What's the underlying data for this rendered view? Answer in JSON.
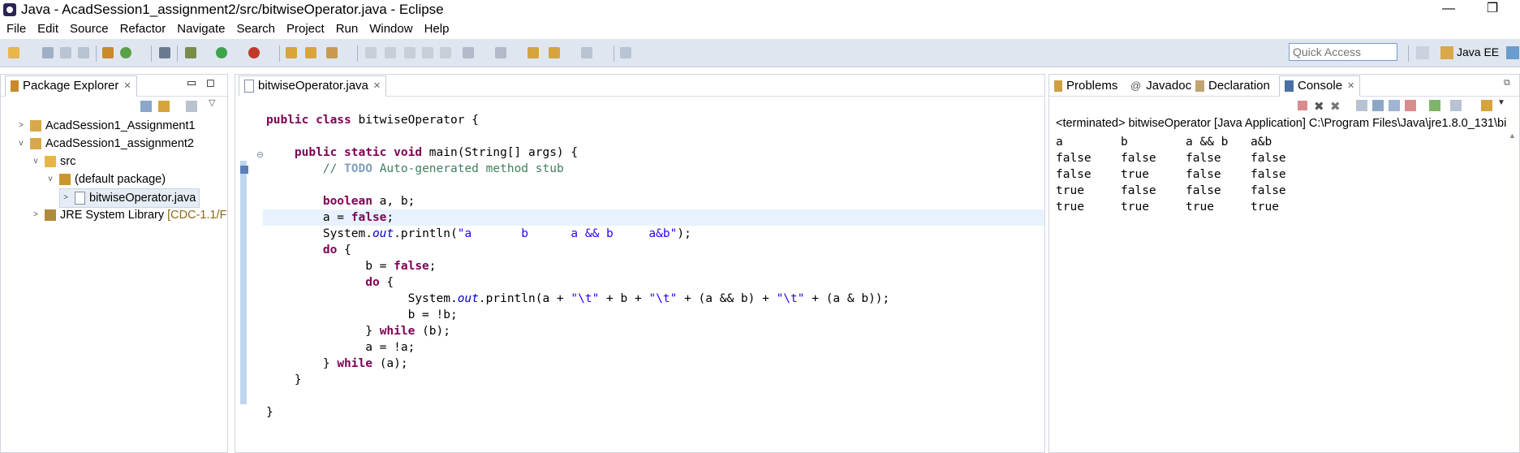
{
  "window": {
    "title": "Java - AcadSession1_assignment2/src/bitwiseOperator.java - Eclipse",
    "minimize": "—",
    "maximize": "❐"
  },
  "menu": [
    "File",
    "Edit",
    "Source",
    "Refactor",
    "Navigate",
    "Search",
    "Project",
    "Run",
    "Window",
    "Help"
  ],
  "toolbar": {
    "quick_access_placeholder": "Quick Access",
    "perspective": "Java EE"
  },
  "package_explorer": {
    "tab": "Package Explorer",
    "items": [
      {
        "label": "AcadSession1_Assignment1",
        "twisty": ">"
      },
      {
        "label": "AcadSession1_assignment2",
        "twisty": "v"
      },
      {
        "label": "src",
        "twisty": "v"
      },
      {
        "label": "(default package)",
        "twisty": "v"
      },
      {
        "label": "bitwiseOperator.java",
        "twisty": ">"
      },
      {
        "label": "JRE System Library",
        "decoration": "[CDC-1.1/F",
        "twisty": ">"
      }
    ]
  },
  "editor": {
    "tab": "bitwiseOperator.java",
    "lines": [
      [
        {
          "t": "public class",
          "c": "kw"
        },
        {
          "t": " bitwiseOperator {"
        }
      ],
      [
        {
          "t": ""
        }
      ],
      [
        {
          "t": "    "
        },
        {
          "t": "public static void",
          "c": "kw"
        },
        {
          "t": " main(String[] args) {"
        }
      ],
      [
        {
          "t": "        "
        },
        {
          "t": "// ",
          "c": "cm"
        },
        {
          "t": "TODO",
          "c": "todo"
        },
        {
          "t": " Auto-generated method stub",
          "c": "cm"
        }
      ],
      [
        {
          "t": ""
        }
      ],
      [
        {
          "t": "        "
        },
        {
          "t": "boolean",
          "c": "kw"
        },
        {
          "t": " a, b;"
        }
      ],
      [
        {
          "t": "        a = "
        },
        {
          "t": "false",
          "c": "kw"
        },
        {
          "t": ";"
        }
      ],
      [
        {
          "t": "        System."
        },
        {
          "t": "out",
          "c": "fld"
        },
        {
          "t": ".println("
        },
        {
          "t": "\"a       b      a && b     a&b\"",
          "c": "str"
        },
        {
          "t": ");"
        }
      ],
      [
        {
          "t": "        "
        },
        {
          "t": "do",
          "c": "kw"
        },
        {
          "t": " {"
        }
      ],
      [
        {
          "t": "              b = "
        },
        {
          "t": "false",
          "c": "kw"
        },
        {
          "t": ";"
        }
      ],
      [
        {
          "t": "              "
        },
        {
          "t": "do",
          "c": "kw"
        },
        {
          "t": " {"
        }
      ],
      [
        {
          "t": "                    System."
        },
        {
          "t": "out",
          "c": "fld"
        },
        {
          "t": ".println(a + "
        },
        {
          "t": "\"\\t\"",
          "c": "str"
        },
        {
          "t": " + b + "
        },
        {
          "t": "\"\\t\"",
          "c": "str"
        },
        {
          "t": " + (a && b) + "
        },
        {
          "t": "\"\\t\"",
          "c": "str"
        },
        {
          "t": " + (a & b));"
        }
      ],
      [
        {
          "t": "                    b = !b;"
        }
      ],
      [
        {
          "t": "              } "
        },
        {
          "t": "while",
          "c": "kw"
        },
        {
          "t": " (b);"
        }
      ],
      [
        {
          "t": "              a = !a;"
        }
      ],
      [
        {
          "t": "        } "
        },
        {
          "t": "while",
          "c": "kw"
        },
        {
          "t": " (a);"
        }
      ],
      [
        {
          "t": "    }"
        }
      ],
      [
        {
          "t": ""
        }
      ],
      [
        {
          "t": "}"
        }
      ]
    ]
  },
  "right_panel": {
    "tabs": [
      "Problems",
      "Javadoc",
      "Declaration",
      "Console"
    ],
    "active_tab": "Console",
    "console_header": "<terminated> bitwiseOperator [Java Application] C:\\Program Files\\Java\\jre1.8.0_131\\bi",
    "console_rows": [
      [
        "a",
        "b",
        "a && b",
        "a&b"
      ],
      [
        "false",
        "false",
        "false",
        "false"
      ],
      [
        "false",
        "true",
        "false",
        "false"
      ],
      [
        "true",
        "false",
        "false",
        "false"
      ],
      [
        "true",
        "true",
        "true",
        "true"
      ]
    ]
  },
  "colors": {
    "keyword": "#7f0055",
    "string": "#2a00ff",
    "comment": "#3f7f5f",
    "toolbar": "#dfe6f0"
  }
}
